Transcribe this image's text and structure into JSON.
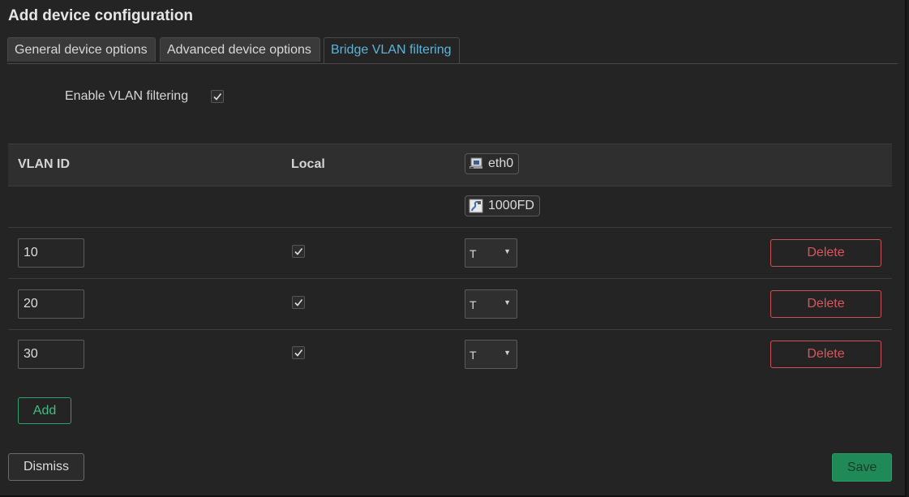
{
  "dialog": {
    "title": "Add device configuration"
  },
  "tabs": [
    {
      "label": "General device options",
      "active": false
    },
    {
      "label": "Advanced device options",
      "active": false
    },
    {
      "label": "Bridge VLAN filtering",
      "active": true
    }
  ],
  "enable_vlan": {
    "label": "Enable VLAN filtering",
    "checked": true
  },
  "table": {
    "headers": {
      "vlan_id": "VLAN ID",
      "local": "Local"
    },
    "port": {
      "name": "eth0",
      "speed": "1000FD",
      "icon": "ethernet-port-icon",
      "link_icon": "link-speed-icon"
    },
    "rows": [
      {
        "vlan_id": "10",
        "local": true,
        "port_mode": "T",
        "delete_label": "Delete"
      },
      {
        "vlan_id": "20",
        "local": true,
        "port_mode": "T",
        "delete_label": "Delete"
      },
      {
        "vlan_id": "30",
        "local": true,
        "port_mode": "T",
        "delete_label": "Delete"
      }
    ]
  },
  "buttons": {
    "add": "Add",
    "dismiss": "Dismiss",
    "save": "Save"
  },
  "colors": {
    "accent_tab": "#5eb4d8",
    "delete": "#d8575d",
    "add": "#3fbf80",
    "save_bg": "#1f8a57"
  }
}
